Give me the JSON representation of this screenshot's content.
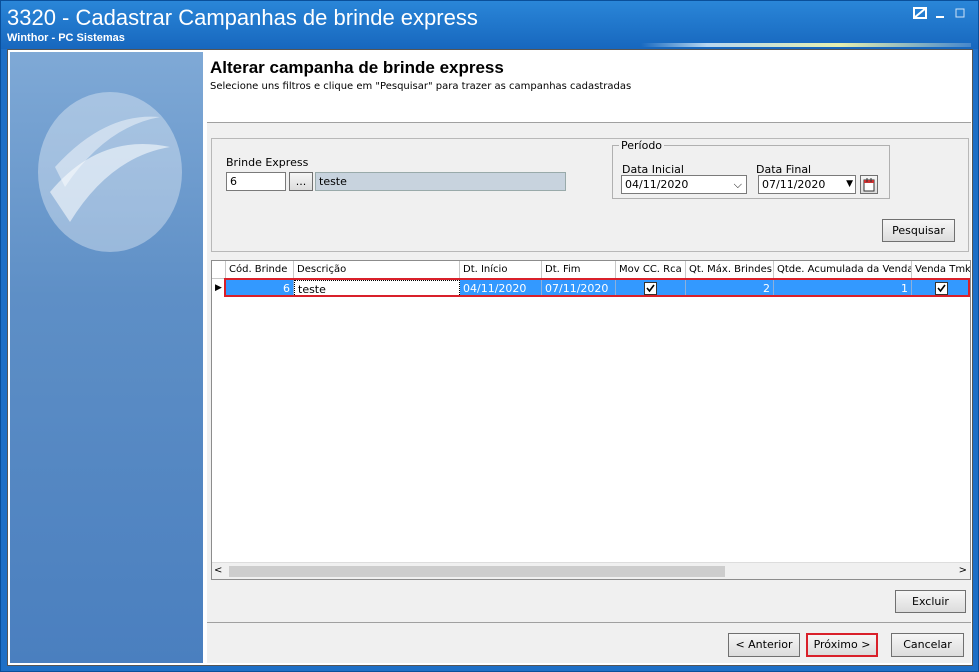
{
  "window": {
    "title": "3320 - Cadastrar Campanhas de brinde express",
    "subtitle": "Winthor - PC Sistemas"
  },
  "header": {
    "title": "Alterar campanha de brinde express",
    "subtitle": "Selecione uns filtros e clique em \"Pesquisar\" para trazer as campanhas cadastradas"
  },
  "filters": {
    "brinde_label": "Brinde Express",
    "brinde_code": "6",
    "browse_label": "...",
    "brinde_desc": "teste",
    "periodo_label": "Período",
    "data_inicial_label": "Data Inicial",
    "data_inicial": "04/11/2020",
    "data_final_label": "Data Final",
    "data_final": "07/11/2020",
    "pesquisar_label": "Pesquisar"
  },
  "grid": {
    "columns": [
      "Cód. Brinde",
      "Descrição",
      "Dt. Início",
      "Dt. Fim",
      "Mov CC. Rca",
      "Qt. Máx. Brindes",
      "Qtde. Acumulada da Venda",
      "Venda Tmk. V"
    ],
    "rows": [
      {
        "cod": "6",
        "descricao": "teste",
        "dt_inicio": "04/11/2020",
        "dt_fim": "07/11/2020",
        "mov_cc_rca": true,
        "qt_max": "2",
        "qtde_acum": "1",
        "venda_tmk": true
      }
    ]
  },
  "buttons": {
    "excluir": "Excluir",
    "anterior": "< Anterior",
    "proximo": "Próximo >",
    "cancelar": "Cancelar"
  },
  "colors": {
    "selection": "#3399ff",
    "highlight": "#d9202a",
    "titlebar": "#1e6fc6"
  }
}
